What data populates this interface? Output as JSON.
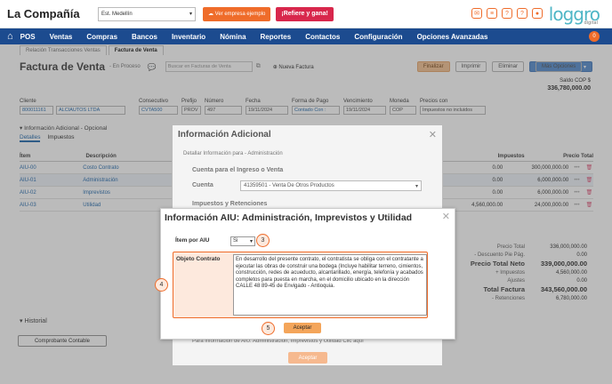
{
  "topbar": {
    "company": "La Compañía",
    "branch": "Est. Medellín",
    "empresa_btn": "Ver empresa ejemplo",
    "refer_btn": "¡Refiere y gana!",
    "logo": "loggro",
    "logo_sub": "digital"
  },
  "nav": {
    "items": [
      "POS",
      "Ventas",
      "Compras",
      "Bancos",
      "Inventario",
      "Nómina",
      "Reportes",
      "Contactos",
      "Configuración",
      "Opciones Avanzadas"
    ],
    "badge": "0"
  },
  "tabs": [
    "Relación Transacciones Ventas",
    "Factura de Venta"
  ],
  "invoice": {
    "title": "Factura de Venta",
    "status": "- En Proceso",
    "search_placeholder": "Buscar en Facturas de Venta",
    "new_label": "Nueva Factura",
    "buttons": {
      "finalizar": "Finalizar",
      "imprimir": "Imprimir",
      "eliminar": "Eliminar",
      "mas": "Más Opciones"
    },
    "saldo_label": "Saldo COP $",
    "saldo_value": "336,780,000.00"
  },
  "fields": {
    "cliente": {
      "label": "Cliente",
      "code": "800011161",
      "name": "ALCIAUTOS LTDA"
    },
    "consecutivo": {
      "label": "Consecutivo",
      "value": "CVTA500"
    },
    "prefijo": {
      "label": "Prefijo",
      "value": "PROV"
    },
    "numero": {
      "label": "Número",
      "value": "497"
    },
    "fecha": {
      "label": "Fecha",
      "value": "19/11/2024"
    },
    "forma_pago": {
      "label": "Forma de Pago",
      "value": "Contado Con :"
    },
    "vencimiento": {
      "label": "Vencimiento",
      "value": "19/11/2024"
    },
    "moneda": {
      "label": "Moneda",
      "value": "COP"
    },
    "precios": {
      "label": "Precios con",
      "value": "Impuestos no incluidos"
    }
  },
  "section": {
    "info_adicional": "Información Adicional - Opcional",
    "subtabs": [
      "Detalles",
      "Impuestos"
    ]
  },
  "items": {
    "headers": [
      "Ítem",
      "Descripción",
      "Impuestos",
      "Precio Total"
    ],
    "rows": [
      {
        "item": "AIU-00",
        "desc": "Costo Contrato",
        "imp": "0.00",
        "total": "300,000,000.00"
      },
      {
        "item": "AIU-01",
        "desc": "Administración",
        "imp": "0.00",
        "total": "6,000,000.00"
      },
      {
        "item": "AIU-02",
        "desc": "Imprevistos",
        "imp": "0.00",
        "total": "6,000,000.00"
      },
      {
        "item": "AIU-03",
        "desc": "Utilidad",
        "imp": "4,560,000.00",
        "total": "24,000,000.00"
      }
    ]
  },
  "totals": [
    {
      "label": "Precio Total",
      "value": "336,000,000.00",
      "big": false
    },
    {
      "label": "- Descuento Pie Pág.",
      "value": "0.00",
      "big": false
    },
    {
      "label": "Precio Total Neto",
      "value": "339,000,000.00",
      "big": true
    },
    {
      "label": "+ Impuestos",
      "value": "4,560,000.00",
      "big": false
    },
    {
      "label": "Ajustes",
      "value": "0.00",
      "big": false
    },
    {
      "label": "Total Factura",
      "value": "343,560,000.00",
      "big": true
    },
    {
      "label": "- Retenciones",
      "value": "6,780,000.00",
      "big": false
    }
  ],
  "historial": "Historial",
  "comprobante": "Comprobante Contable",
  "modal_info": {
    "title": "Información Adicional",
    "sub": "Detallar Información para - Administración",
    "cuenta_section": "Cuenta para el Ingreso o Venta",
    "cuenta_label": "Cuenta",
    "cuenta_value": "41359501 - Venta De Otros Productos",
    "impuestos_section": "Impuestos y Retenciones",
    "footer": "Para información de AIU: Administración, Imprevistos y Utilidad Clic aquí",
    "aceptar": "Aceptar"
  },
  "modal_aiu": {
    "title": "Información AIU: Administración, Imprevistos y Utilidad",
    "item_label": "Ítem por AIU",
    "item_value": "Si",
    "objeto_label": "Objeto Contrato",
    "objeto_text": "En desarrollo del presente contrato, el contratista se obliga con el contratante a ejecutar las obras de construir una bodega (Incluye habilitar terreno, cimientos, construcción, redes de acueducto, alcantarillado, energía, telefonía y acabados completos para puesta en marcha, en el domicilio ubicado en la dirección CALLE 48 89-45 de Envigado - Antioquia.",
    "aceptar": "Aceptar"
  },
  "callouts": [
    "3",
    "4",
    "5"
  ],
  "colors": {
    "accent": "#ef6c2a",
    "nav": "#1c4b8f",
    "refer": "#d8274c"
  }
}
